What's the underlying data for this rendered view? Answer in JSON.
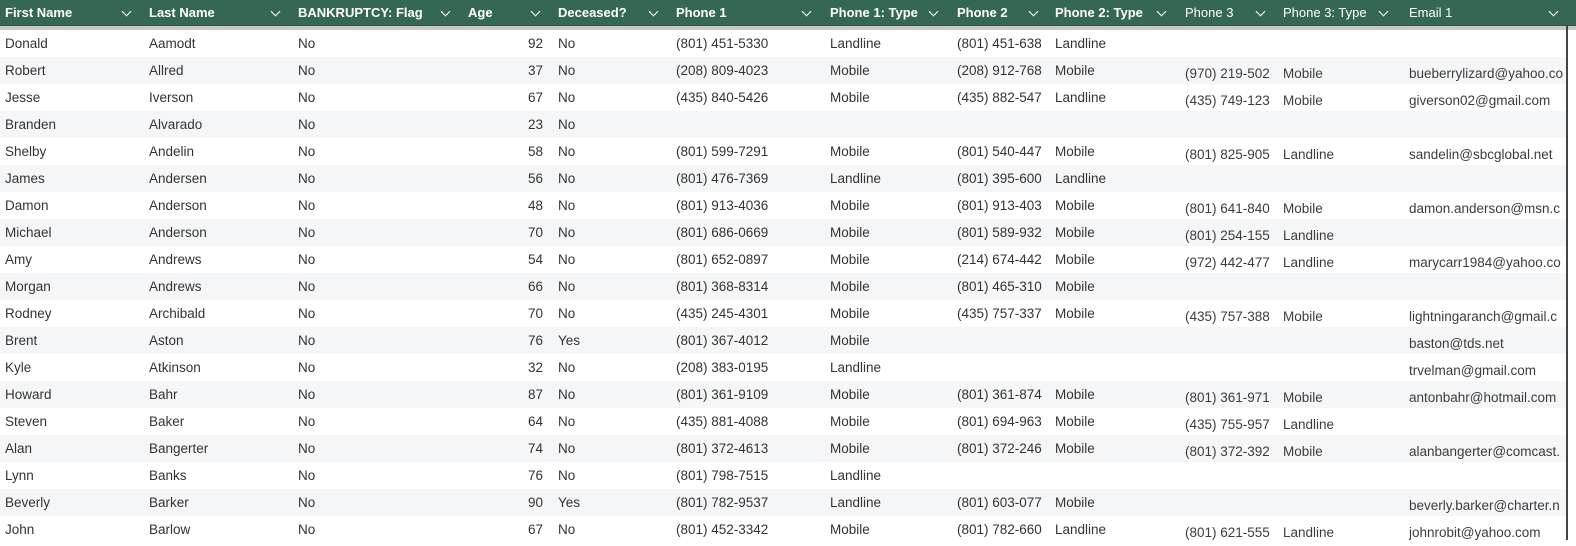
{
  "columns": [
    "First Name",
    "Last Name",
    "BANKRUPTCY: Flag",
    "Age",
    "Deceased?",
    "Phone 1",
    "Phone 1: Type",
    "Phone 2",
    "Phone 2: Type",
    "Phone 3",
    "Phone 3: Type",
    "Email 1"
  ],
  "icons": {
    "column_menu": "chevron-down-icon"
  },
  "colors": {
    "header_bg": "#356852",
    "row_alt": "#f5f6f8"
  },
  "rows": [
    [
      "Donald",
      "Aamodt",
      "No",
      "92",
      "No",
      "(801) 451-5330",
      "Landline",
      "(801) 451-638",
      "Landline",
      "",
      "",
      ""
    ],
    [
      "Robert",
      "Allred",
      "No",
      "37",
      "No",
      "(208) 809-4023",
      "Mobile",
      "(208) 912-768",
      "Mobile",
      "(970) 219-502",
      "Mobile",
      "bueberrylizard@yahoo.co"
    ],
    [
      "Jesse",
      "Iverson",
      "No",
      "67",
      "No",
      "(435) 840-5426",
      "Mobile",
      "(435) 882-547",
      "Landline",
      "(435) 749-123",
      "Mobile",
      "giverson02@gmail.com"
    ],
    [
      "Branden",
      "Alvarado",
      "No",
      "23",
      "No",
      "",
      "",
      "",
      "",
      "",
      "",
      ""
    ],
    [
      "Shelby",
      "Andelin",
      "No",
      "58",
      "No",
      "(801) 599-7291",
      "Mobile",
      "(801) 540-447",
      "Mobile",
      "(801) 825-905",
      "Landline",
      "sandelin@sbcglobal.net"
    ],
    [
      "James",
      "Andersen",
      "No",
      "56",
      "No",
      "(801) 476-7369",
      "Landline",
      "(801) 395-600",
      "Landline",
      "",
      "",
      ""
    ],
    [
      "Damon",
      "Anderson",
      "No",
      "48",
      "No",
      "(801) 913-4036",
      "Mobile",
      "(801) 913-403",
      "Mobile",
      "(801) 641-840",
      "Mobile",
      "damon.anderson@msn.c"
    ],
    [
      "Michael",
      "Anderson",
      "No",
      "70",
      "No",
      "(801) 686-0669",
      "Mobile",
      "(801) 589-932",
      "Mobile",
      "(801) 254-155",
      "Landline",
      ""
    ],
    [
      "Amy",
      "Andrews",
      "No",
      "54",
      "No",
      "(801) 652-0897",
      "Mobile",
      "(214) 674-442",
      "Mobile",
      "(972) 442-477",
      "Landline",
      "marycarr1984@yahoo.co"
    ],
    [
      "Morgan",
      "Andrews",
      "No",
      "66",
      "No",
      "(801) 368-8314",
      "Mobile",
      "(801) 465-310",
      "Mobile",
      "",
      "",
      ""
    ],
    [
      "Rodney",
      "Archibald",
      "No",
      "70",
      "No",
      "(435) 245-4301",
      "Mobile",
      "(435) 757-337",
      "Mobile",
      "(435) 757-388",
      "Mobile",
      "lightningaranch@gmail.c"
    ],
    [
      "Brent",
      "Aston",
      "No",
      "76",
      "Yes",
      "(801) 367-4012",
      "Mobile",
      "",
      "",
      "",
      "",
      "baston@tds.net"
    ],
    [
      "Kyle",
      "Atkinson",
      "No",
      "32",
      "No",
      "(208) 383-0195",
      "Landline",
      "",
      "",
      "",
      "",
      "trvelman@gmail.com"
    ],
    [
      "Howard",
      "Bahr",
      "No",
      "87",
      "No",
      "(801) 361-9109",
      "Mobile",
      "(801) 361-874",
      "Mobile",
      "(801) 361-971",
      "Mobile",
      "antonbahr@hotmail.com"
    ],
    [
      "Steven",
      "Baker",
      "No",
      "64",
      "No",
      "(435) 881-4088",
      "Mobile",
      "(801) 694-963",
      "Mobile",
      "(435) 755-957",
      "Landline",
      ""
    ],
    [
      "Alan",
      "Bangerter",
      "No",
      "74",
      "No",
      "(801) 372-4613",
      "Mobile",
      "(801) 372-246",
      "Mobile",
      "(801) 372-392",
      "Mobile",
      "alanbangerter@comcast."
    ],
    [
      "Lynn",
      "Banks",
      "No",
      "76",
      "No",
      "(801) 798-7515",
      "Landline",
      "",
      "",
      "",
      "",
      ""
    ],
    [
      "Beverly",
      "Barker",
      "No",
      "90",
      "Yes",
      "(801) 782-9537",
      "Landline",
      "(801) 603-077",
      "Mobile",
      "",
      "",
      "beverly.barker@charter.n"
    ],
    [
      "John",
      "Barlow",
      "No",
      "67",
      "No",
      "(801) 452-3342",
      "Mobile",
      "(801) 782-660",
      "Landline",
      "(801) 621-555",
      "Landline",
      "johnrobit@yahoo.com"
    ]
  ]
}
